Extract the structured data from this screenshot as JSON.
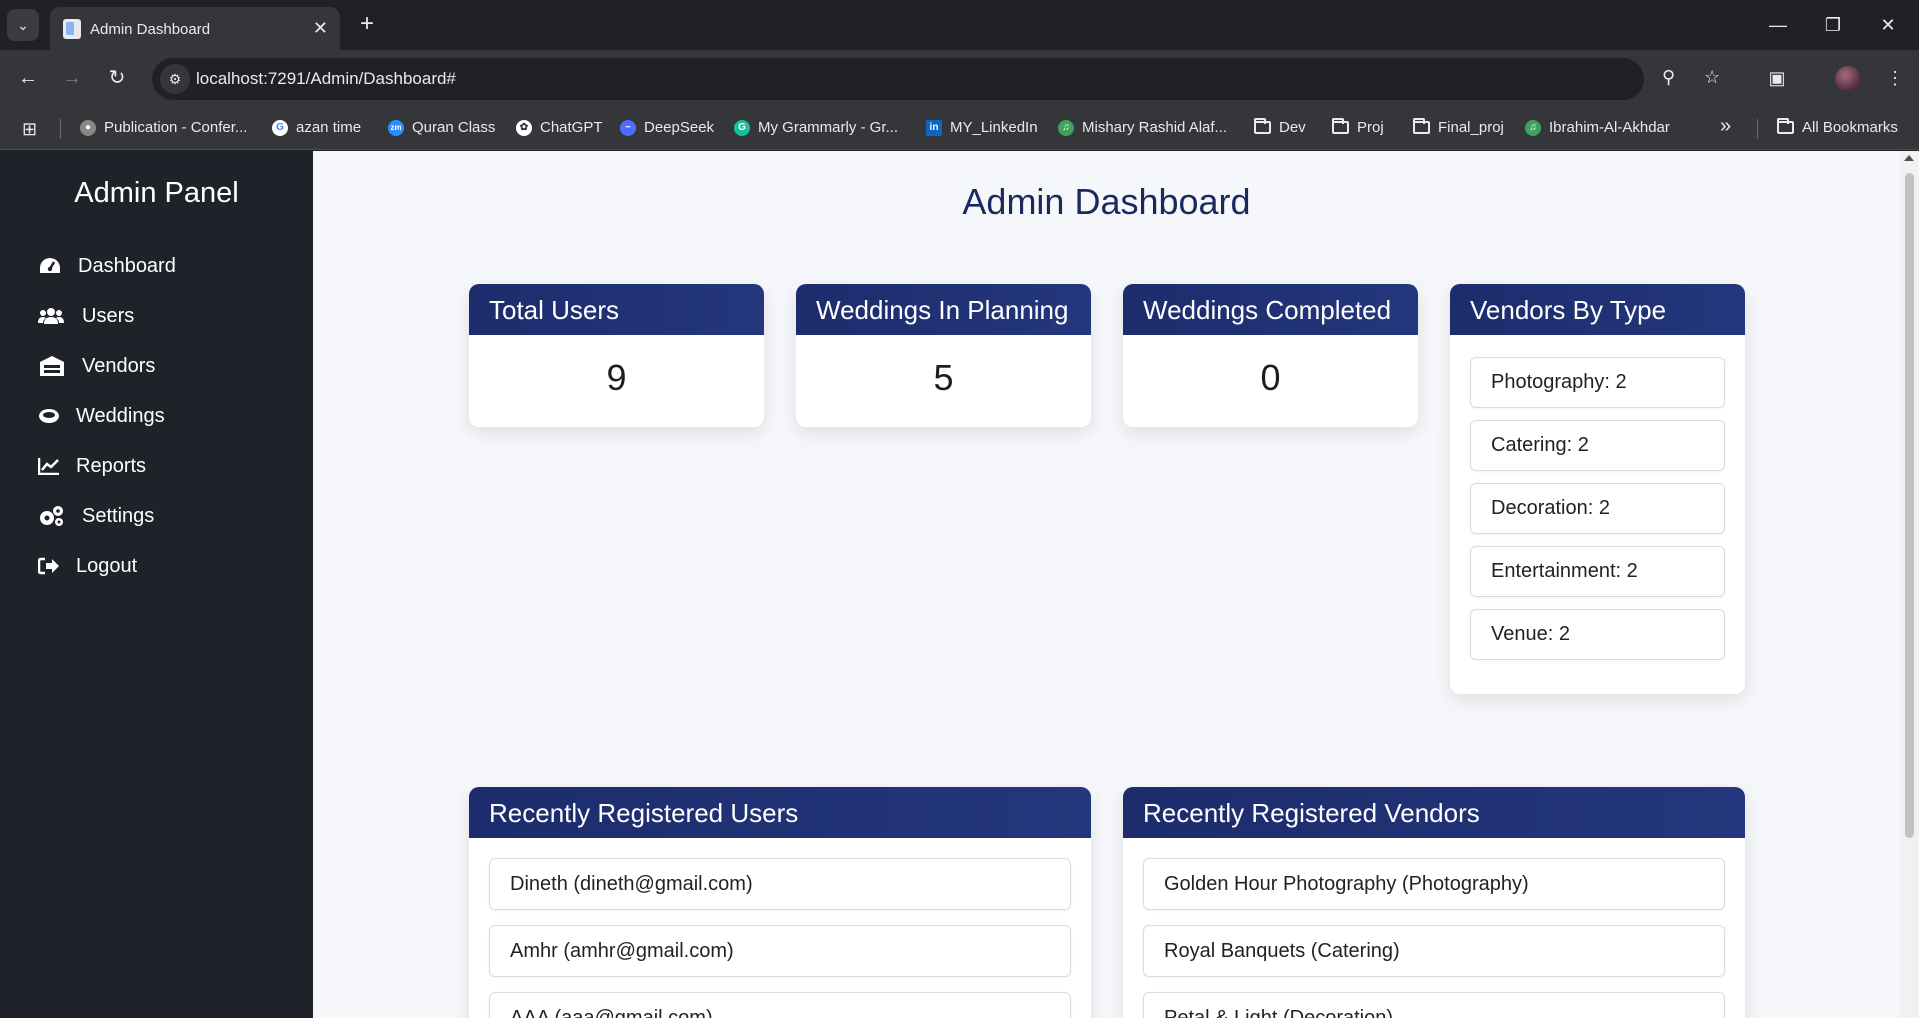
{
  "browser": {
    "tab_title": "Admin Dashboard",
    "url": "localhost:7291/Admin/Dashboard#",
    "bookmarks": [
      {
        "label": "Publication - Confer...",
        "icon": "globe-icon"
      },
      {
        "label": "azan time",
        "icon": "google-icon"
      },
      {
        "label": "Quran Class",
        "icon": "zoom-icon"
      },
      {
        "label": "ChatGPT",
        "icon": "chatgpt-icon"
      },
      {
        "label": "DeepSeek",
        "icon": "deepseek-icon"
      },
      {
        "label": "My Grammarly - Gr...",
        "icon": "grammarly-icon"
      },
      {
        "label": "MY_LinkedIn",
        "icon": "linkedin-icon"
      },
      {
        "label": "Mishary Rashid Alaf...",
        "icon": "audio-icon"
      },
      {
        "label": "Dev",
        "icon": "folder-icon"
      },
      {
        "label": "Proj",
        "icon": "folder-icon"
      },
      {
        "label": "Final_proj",
        "icon": "folder-icon"
      },
      {
        "label": "Ibrahim-Al-Akhdar",
        "icon": "audio-icon"
      }
    ],
    "all_bookmarks": "All Bookmarks"
  },
  "sidebar": {
    "title": "Admin Panel",
    "items": [
      {
        "label": "Dashboard",
        "icon": "dashboard-icon"
      },
      {
        "label": "Users",
        "icon": "users-icon"
      },
      {
        "label": "Vendors",
        "icon": "store-icon"
      },
      {
        "label": "Weddings",
        "icon": "ring-icon"
      },
      {
        "label": "Reports",
        "icon": "chart-icon"
      },
      {
        "label": "Settings",
        "icon": "gears-icon"
      },
      {
        "label": "Logout",
        "icon": "logout-icon"
      }
    ]
  },
  "main": {
    "title": "Admin Dashboard",
    "stats": [
      {
        "label": "Total Users",
        "value": "9"
      },
      {
        "label": "Weddings In Planning",
        "value": "5"
      },
      {
        "label": "Weddings Completed",
        "value": "0"
      }
    ],
    "vendors_by_type": {
      "label": "Vendors By Type",
      "items": [
        "Photography: 2",
        "Catering: 2",
        "Decoration: 2",
        "Entertainment: 2",
        "Venue: 2"
      ]
    },
    "recent_users": {
      "label": "Recently Registered Users",
      "items": [
        "Dineth (dineth@gmail.com)",
        "Amhr (amhr@gmail.com)",
        "AAA (aaa@gmail.com)"
      ]
    },
    "recent_vendors": {
      "label": "Recently Registered Vendors",
      "items": [
        "Golden Hour Photography (Photography)",
        "Royal Banquets (Catering)",
        "Petal & Light (Decoration)"
      ]
    }
  }
}
